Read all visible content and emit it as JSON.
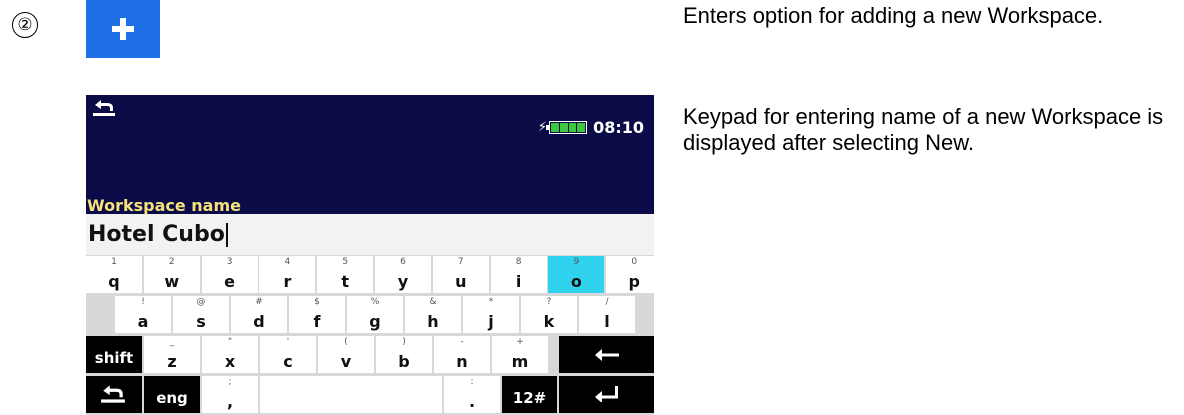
{
  "step": {
    "number": "②"
  },
  "add_button": {
    "icon": "plus-icon",
    "color": "#1f6fe6"
  },
  "descriptions": {
    "first": "Enters option for adding a new Workspace.",
    "second": "Keypad for entering name of a new Workspace is displayed after selecting New."
  },
  "device": {
    "header": {
      "back_icon": "back-arrow-icon",
      "time": "08:10",
      "battery_icon": "battery-charging-icon",
      "background": "#0b0b48"
    },
    "field_label": "Workspace name",
    "field_value": "Hotel Cubo",
    "keyboard": {
      "row1": [
        {
          "pri": "q",
          "sec": "1"
        },
        {
          "pri": "w",
          "sec": "2"
        },
        {
          "pri": "e",
          "sec": "3"
        },
        {
          "pri": "r",
          "sec": "4"
        },
        {
          "pri": "t",
          "sec": "5"
        },
        {
          "pri": "y",
          "sec": "6"
        },
        {
          "pri": "u",
          "sec": "7"
        },
        {
          "pri": "i",
          "sec": "8"
        },
        {
          "pri": "o",
          "sec": "9"
        },
        {
          "pri": "p",
          "sec": "0"
        }
      ],
      "row2": [
        {
          "pri": "a",
          "sec": "!"
        },
        {
          "pri": "s",
          "sec": "@"
        },
        {
          "pri": "d",
          "sec": "#"
        },
        {
          "pri": "f",
          "sec": "$"
        },
        {
          "pri": "g",
          "sec": "%"
        },
        {
          "pri": "h",
          "sec": "&"
        },
        {
          "pri": "j",
          "sec": "*"
        },
        {
          "pri": "k",
          "sec": "?"
        },
        {
          "pri": "l",
          "sec": "/"
        }
      ],
      "row3": [
        {
          "pri": "z",
          "sec": "_"
        },
        {
          "pri": "x",
          "sec": "\""
        },
        {
          "pri": "c",
          "sec": "'"
        },
        {
          "pri": "v",
          "sec": "("
        },
        {
          "pri": "b",
          "sec": ")"
        },
        {
          "pri": "n",
          "sec": "-"
        },
        {
          "pri": "m",
          "sec": "+"
        }
      ],
      "shift_label": "shift",
      "lang_label": "eng",
      "comma": {
        "pri": ",",
        "sec": ";"
      },
      "period": {
        "pri": ".",
        "sec": ":"
      },
      "symbols_label": "12#",
      "highlight_key": "o",
      "highlight_color": "#2fd3ee"
    }
  }
}
